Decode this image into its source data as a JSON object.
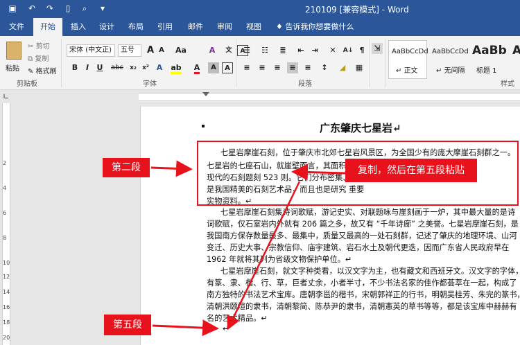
{
  "app": {
    "title": "210109 [兼容模式] - Word"
  },
  "tabs": [
    {
      "label": "文件"
    },
    {
      "label": "开始"
    },
    {
      "label": "插入"
    },
    {
      "label": "设计"
    },
    {
      "label": "布局"
    },
    {
      "label": "引用"
    },
    {
      "label": "邮件"
    },
    {
      "label": "审阅"
    },
    {
      "label": "视图"
    }
  ],
  "tell_me": "告诉我你想要做什么",
  "ribbon": {
    "clipboard": {
      "paste": "粘贴",
      "cut": "剪切",
      "copy": "复制",
      "format_painter": "格式刷",
      "label": "剪贴板"
    },
    "font": {
      "font_name": "宋体 (中文正)",
      "font_size": "五号",
      "aa_label": "Aa",
      "label": "字体"
    },
    "paragraph": {
      "label": "段落"
    },
    "styles": {
      "items": [
        {
          "sample": "AaBbCcDd",
          "name": "正文"
        },
        {
          "sample": "AaBbCcDd",
          "name": "无间隔"
        },
        {
          "sample": "AaBb",
          "name": "标题 1"
        },
        {
          "sample": "A",
          "name": ""
        }
      ],
      "label": "样式"
    }
  },
  "ruler_v_numbers": [
    "2",
    "4",
    "6",
    "8",
    "10",
    "12",
    "14",
    "16",
    "18",
    "20"
  ],
  "document": {
    "title": "广东肇庆七星岩",
    "lines": [
      "七星岩摩崖石刻，位于肇庆市北郊七星岩风景区，为全国少有的庞大摩崖石刻群之一。",
      "七星岩的七座石山，就崖壁而言，其面积                                      下至",
      "现代的石刻题刻 523 则。它们分布密集、                                     不仅",
      "是我国精美的石刻艺术品，而且也是研究                                     重要",
      "实物资料。",
      "七星岩摩崖石刻集诗词歌赋，游记史实、对联题咏与崖刻画于一炉，其中最大量的是诗",
      "词歌赋，仅石室岩内外就有 206 篇之多，故又有 “千年诗廊” 之美誉。七星岩摩崖石刻，是",
      "我国南方保存数量最多、最集中，质量又最高的一处石刻群，记述了肇庆的地理环境、山河",
      "变迁、历史大事、宗教信仰、庙宇建筑、岩石水土及朝代更迭，因而广东省人民政府早在",
      "1962 年就将其列为省级文物保护单位。",
      "七星岩摩崖石刻，就文字种类看，以汉文字为主，也有藏文和西班牙文。汉文字的字体，",
      "有篆、隶、楷、行、草，巨者丈余，小者半寸，不少书法名家的佳作都荟萃在一起，构成了",
      "南方独特的书法艺术宝库。唐朝李邕的楷书，宋朝郭祥正的行书，明朝吴桂芳、朱完的篆书，",
      "清朝洪颐煊的隶书，清朝黎简、陈恭尹的隶书，清朝憲英的草书等等，都是该宝库中赫赫有",
      "名的艺术精品。"
    ]
  },
  "annotations": {
    "second_para": "第二段",
    "copy_paste": "复制，然后在第五段粘贴",
    "fifth_para": "第五段"
  },
  "colors": {
    "word_blue": "#2b579a",
    "callout_red": "#e8121d"
  }
}
